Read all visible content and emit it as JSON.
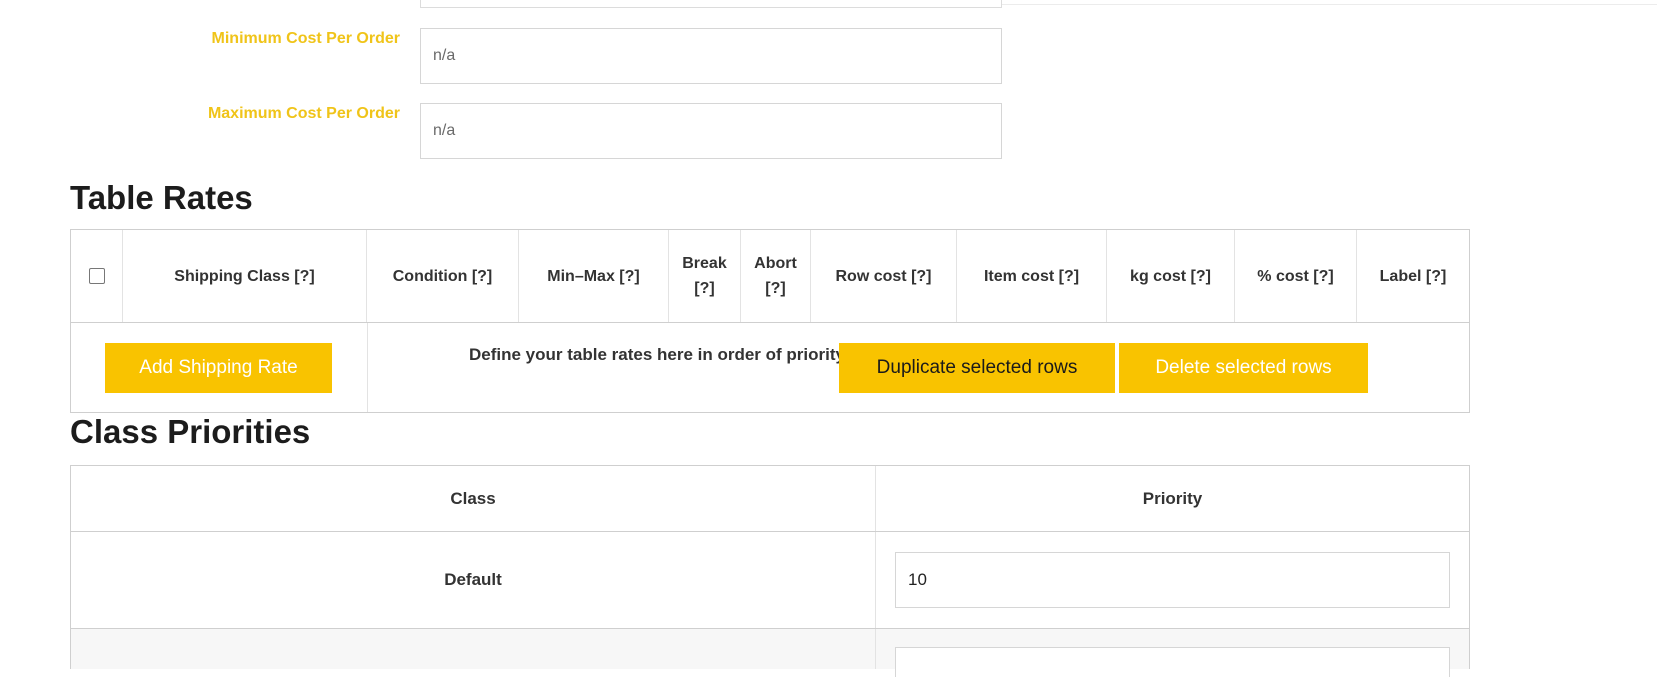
{
  "form": {
    "min_cost_label": "Minimum Cost Per Order",
    "min_cost_placeholder": "n/a",
    "max_cost_label": "Maximum Cost Per Order",
    "max_cost_placeholder": "n/a"
  },
  "table_rates": {
    "heading": "Table Rates",
    "columns": [
      "Shipping Class [?]",
      "Condition [?]",
      "Min–Max [?]",
      "Break [?]",
      "Abort [?]",
      "Row cost [?]",
      "Item cost [?]",
      "kg cost [?]",
      "% cost [?]",
      "Label [?]"
    ],
    "add_button": "Add Shipping Rate",
    "help_text": "Define your table rates here in order of priority.",
    "duplicate_button": "Duplicate selected rows",
    "delete_button": "Delete selected rows"
  },
  "class_priorities": {
    "heading": "Class Priorities",
    "col_class": "Class",
    "col_priority": "Priority",
    "rows": [
      {
        "class": "Default",
        "priority": "10"
      }
    ]
  },
  "colors": {
    "accent": "#f9c300",
    "label_yellow": "#f0c419"
  }
}
